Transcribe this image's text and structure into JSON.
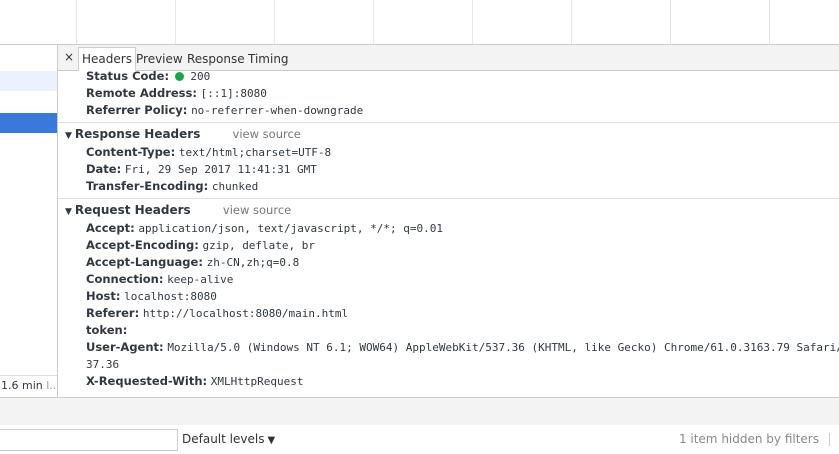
{
  "left_pane": {
    "status_text": "1.6 min",
    "status_sep": "l..."
  },
  "detail_tabs": {
    "close": "×",
    "tabs": [
      {
        "label": "Headers",
        "active": true
      },
      {
        "label": "Preview",
        "active": false
      },
      {
        "label": "Response",
        "active": false
      },
      {
        "label": "Timing",
        "active": false
      }
    ]
  },
  "general": {
    "status_code": {
      "key": "Status Code:",
      "value": "200",
      "status_color": "#1aa34a"
    },
    "remote_address": {
      "key": "Remote Address:",
      "value": "[::1]:8080"
    },
    "referrer_policy": {
      "key": "Referrer Policy:",
      "value": "no-referrer-when-downgrade"
    }
  },
  "response_headers": {
    "title": "Response Headers",
    "view_source": "view source",
    "items": [
      {
        "key": "Content-Type:",
        "value": "text/html;charset=UTF-8"
      },
      {
        "key": "Date:",
        "value": "Fri, 29 Sep 2017 11:41:31 GMT"
      },
      {
        "key": "Transfer-Encoding:",
        "value": "chunked"
      }
    ]
  },
  "request_headers": {
    "title": "Request Headers",
    "view_source": "view source",
    "items": [
      {
        "key": "Accept:",
        "value": "application/json, text/javascript, */*; q=0.01"
      },
      {
        "key": "Accept-Encoding:",
        "value": "gzip, deflate, br"
      },
      {
        "key": "Accept-Language:",
        "value": "zh-CN,zh;q=0.8"
      },
      {
        "key": "Connection:",
        "value": "keep-alive"
      },
      {
        "key": "Host:",
        "value": "localhost:8080"
      },
      {
        "key": "Referer:",
        "value": "http://localhost:8080/main.html"
      },
      {
        "key": "token:",
        "value": ""
      },
      {
        "key": "User-Agent:",
        "value": "Mozilla/5.0 (Windows NT 6.1; WOW64) AppleWebKit/537.36 (KHTML, like Gecko) Chrome/61.0.3163.79 Safari/5"
      },
      {
        "key": "",
        "value": "37.36"
      },
      {
        "key": "X-Requested-With:",
        "value": "XMLHttpRequest"
      }
    ]
  },
  "console": {
    "levels_label": "Default levels",
    "hidden_note": "1 item hidden by filters"
  }
}
